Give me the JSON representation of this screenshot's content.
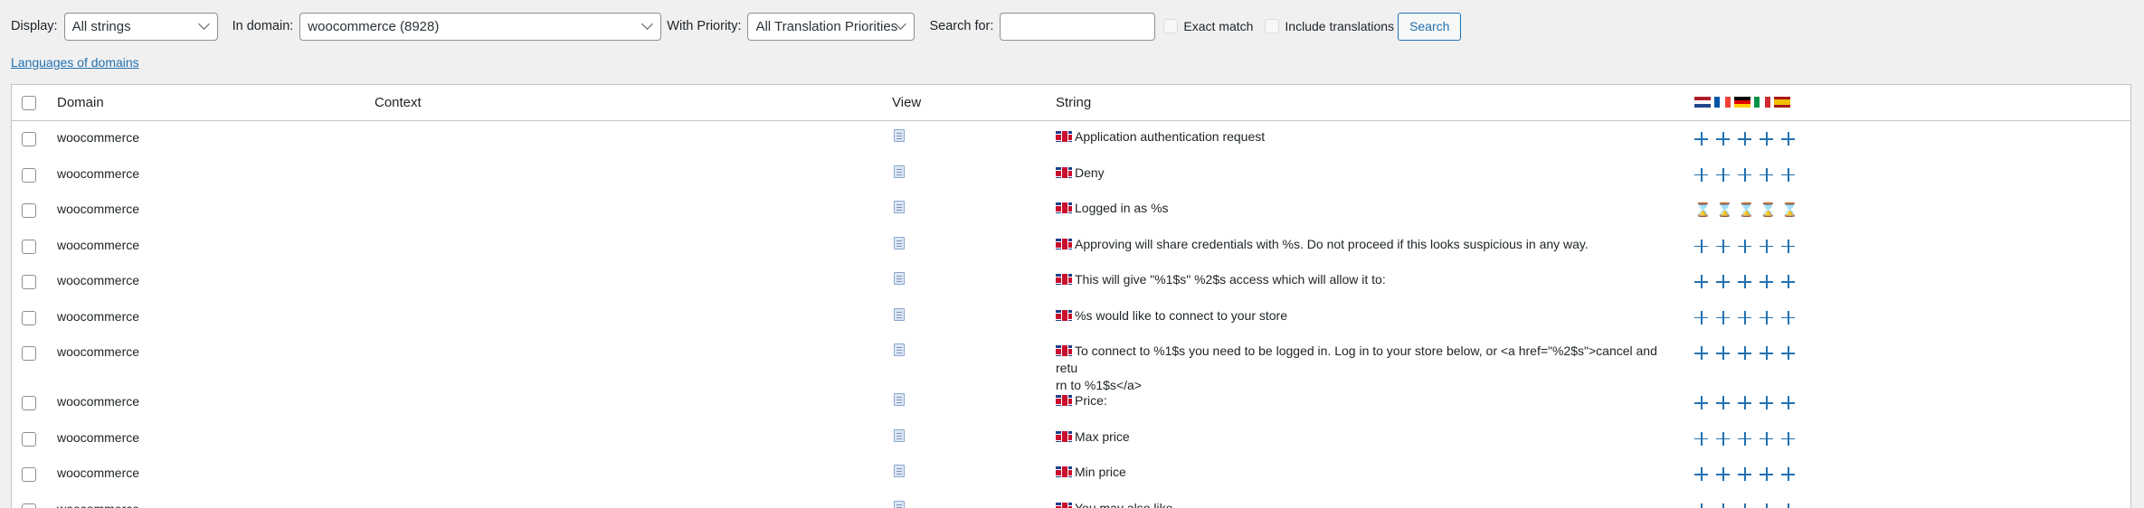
{
  "filters": {
    "display_label": "Display:",
    "display_value": "All strings",
    "domain_label": "In domain:",
    "domain_value": "woocommerce (8928)",
    "priority_label": "With Priority:",
    "priority_value": "All Translation Priorities",
    "search_label": "Search for:",
    "search_value": "",
    "exact_match_label": "Exact match",
    "include_translations_label": "Include translations",
    "search_button": "Search"
  },
  "languages_link": "Languages of domains",
  "table": {
    "headers": {
      "domain": "Domain",
      "context": "Context",
      "view": "View",
      "string": "String"
    },
    "language_flags": [
      "nl-flag-icon",
      "fr-flag-icon",
      "de-flag-icon",
      "it-flag-icon",
      "es-flag-icon"
    ],
    "rows": [
      {
        "domain": "woocommerce",
        "context": "",
        "string": "Application authentication request",
        "status": "add"
      },
      {
        "domain": "woocommerce",
        "context": "",
        "string": "Deny",
        "status": "add"
      },
      {
        "domain": "woocommerce",
        "context": "",
        "string": "Logged in as %s",
        "status": "pending"
      },
      {
        "domain": "woocommerce",
        "context": "",
        "string": "Approving will share credentials with %s. Do not proceed if this looks suspicious in any way.",
        "status": "add"
      },
      {
        "domain": "woocommerce",
        "context": "",
        "string": "This will give \"%1$s\" %2$s access which will allow it to:",
        "status": "add"
      },
      {
        "domain": "woocommerce",
        "context": "",
        "string": "%s would like to connect to your store",
        "status": "add"
      },
      {
        "domain": "woocommerce",
        "context": "",
        "string_line1": "To connect to %1$s you need to be logged in. Log in to your store below, or <a href=\"%2$s\">cancel and retu",
        "string_line2": "rn to %1$s</a>",
        "status": "add"
      },
      {
        "domain": "woocommerce",
        "context": "",
        "string": "Price:",
        "status": "add"
      },
      {
        "domain": "woocommerce",
        "context": "",
        "string": "Max price",
        "status": "add"
      },
      {
        "domain": "woocommerce",
        "context": "",
        "string": "Min price",
        "status": "add"
      },
      {
        "domain": "woocommerce",
        "context": "",
        "string": "You may also like",
        "status": "add"
      }
    ]
  },
  "colors": {
    "accent": "#2271b1",
    "background": "#f0f0f1",
    "border": "#c3c4c7"
  }
}
